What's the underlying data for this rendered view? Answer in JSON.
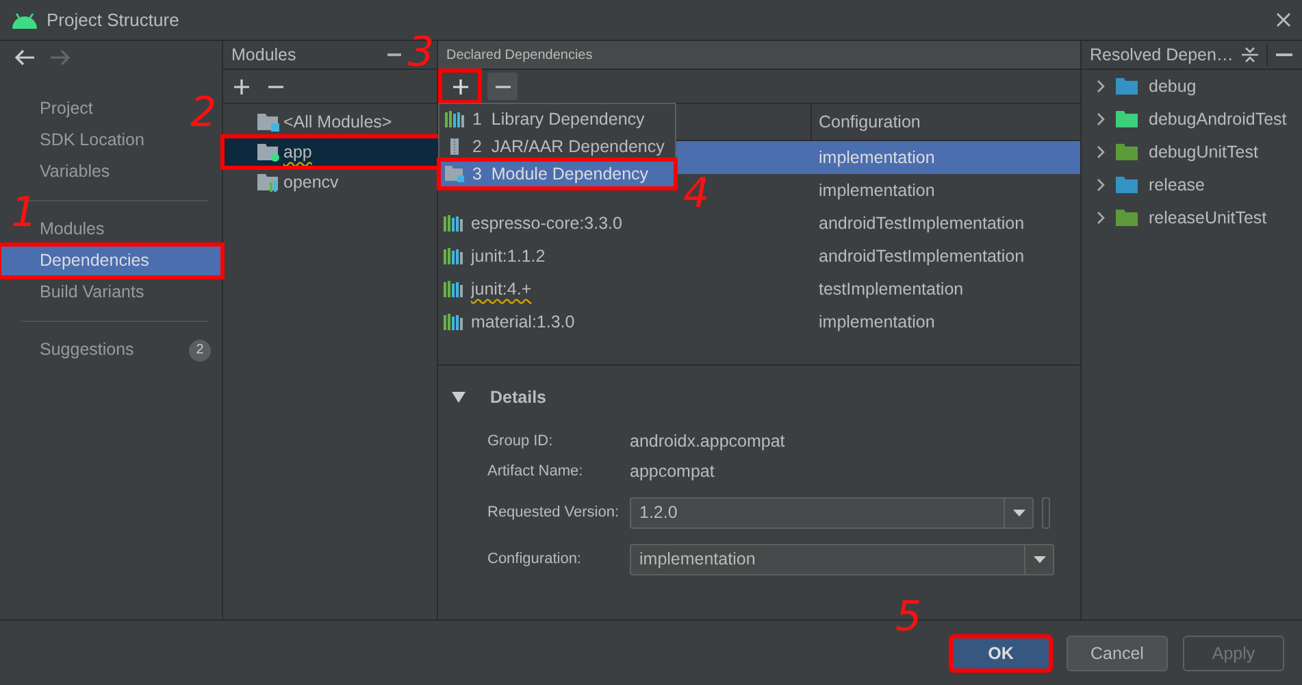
{
  "window": {
    "title": "Project Structure"
  },
  "sidebar": {
    "groups": [
      [
        {
          "label": "Project",
          "selected": false
        },
        {
          "label": "SDK Location",
          "selected": false
        },
        {
          "label": "Variables",
          "selected": false
        }
      ],
      [
        {
          "label": "Modules",
          "selected": false
        },
        {
          "label": "Dependencies",
          "selected": true,
          "highlighted": true,
          "callout": "1"
        },
        {
          "label": "Build Variants",
          "selected": false
        }
      ],
      [
        {
          "label": "Suggestions",
          "selected": false,
          "badge": "2"
        }
      ]
    ]
  },
  "modules": {
    "title": "Modules",
    "items": [
      {
        "label": "<All Modules>",
        "kind": "all",
        "selected": false
      },
      {
        "label": "app",
        "kind": "app",
        "selected": true,
        "warning": true,
        "highlighted": true,
        "callout": "2"
      },
      {
        "label": "opencv",
        "kind": "library",
        "selected": false
      }
    ]
  },
  "declared": {
    "title": "Declared Dependencies",
    "add_button": {
      "highlighted": true,
      "callout": "3"
    },
    "columns": [
      "Configuration"
    ],
    "rows": [
      {
        "configuration": "implementation",
        "selected": true
      },
      {
        "configuration": "implementation",
        "selected": false
      },
      {
        "name": "espresso-core:3.3.0",
        "configuration": "androidTestImplementation",
        "selected": false
      },
      {
        "name": "junit:1.1.2",
        "configuration": "androidTestImplementation",
        "selected": false
      },
      {
        "name": "junit:4.+",
        "configuration": "testImplementation",
        "selected": false,
        "warning": true
      },
      {
        "name": "material:1.3.0",
        "configuration": "implementation",
        "selected": false
      }
    ],
    "menu": {
      "items": [
        {
          "number": "1",
          "label": "Library Dependency",
          "kind": "library",
          "selected": false
        },
        {
          "number": "2",
          "label": "JAR/AAR Dependency",
          "kind": "jar",
          "selected": false
        },
        {
          "number": "3",
          "label": "Module Dependency",
          "kind": "module",
          "selected": true,
          "highlighted": true,
          "callout": "4"
        }
      ]
    }
  },
  "details": {
    "title": "Details",
    "expanded": true,
    "fields": [
      {
        "label": "Group ID:",
        "value": "androidx.appcompat",
        "kind": "text"
      },
      {
        "label": "Artifact Name:",
        "value": "appcompat",
        "kind": "text"
      },
      {
        "label": "Requested Version:",
        "value": "1.2.0",
        "kind": "combo"
      },
      {
        "label": "Configuration:",
        "value": "implementation",
        "kind": "dropdown"
      }
    ]
  },
  "resolved": {
    "title": "Resolved Depen…",
    "items": [
      {
        "label": "debug",
        "color": "#3592c4"
      },
      {
        "label": "debugAndroidTest",
        "color": "#3ecf7d"
      },
      {
        "label": "debugUnitTest",
        "color": "#5d9b3a"
      },
      {
        "label": "release",
        "color": "#3592c4"
      },
      {
        "label": "releaseUnitTest",
        "color": "#5d9b3a"
      }
    ]
  },
  "buttons": [
    {
      "label": "OK",
      "kind": "primary",
      "highlighted": true,
      "callout": "5"
    },
    {
      "label": "Cancel",
      "kind": "normal"
    },
    {
      "label": "Apply",
      "kind": "disabled"
    }
  ]
}
